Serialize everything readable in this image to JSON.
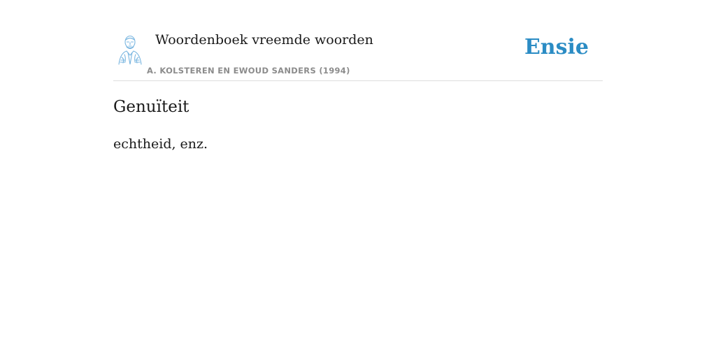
{
  "header": {
    "book_title": "Woordenboek vreemde woorden",
    "authors": "A. KOLSTEREN EN EWOUD SANDERS (1994)",
    "brand": "Ensie",
    "portrait_icon": "author-portrait-icon"
  },
  "entry": {
    "term": "Genuïteit",
    "definition": "echtheid, enz."
  },
  "colors": {
    "brand": "#2b8cc4",
    "text": "#1a1a1a",
    "muted": "#8c8c8c",
    "divider": "#dddddd",
    "portrait": "#7ab6e0"
  }
}
